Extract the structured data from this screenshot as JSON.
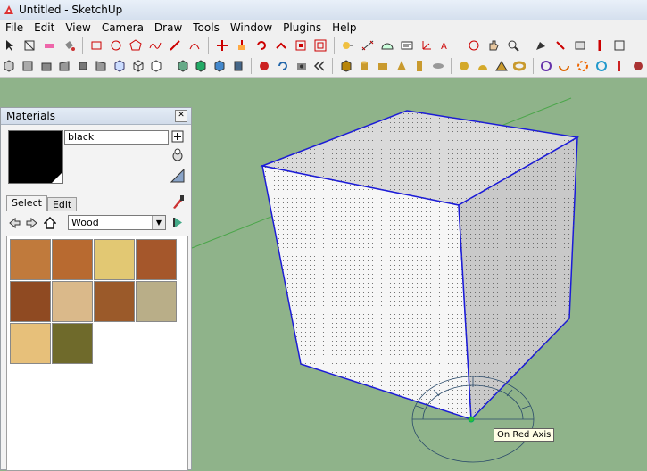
{
  "window": {
    "title": "Untitled - SketchUp"
  },
  "menu": [
    "File",
    "Edit",
    "View",
    "Camera",
    "Draw",
    "Tools",
    "Window",
    "Plugins",
    "Help"
  ],
  "materials_panel": {
    "title": "Materials",
    "material_name": "black",
    "tabs": [
      "Select",
      "Edit"
    ],
    "collection": "Wood",
    "swatch_colors": [
      "#c07a3c",
      "#b86a30",
      "#e2c873",
      "#a5572b",
      "#8f4a22",
      "#dab98a",
      "#9b5a2a",
      "#b9ae88",
      "#e7c07a",
      "#6f6a2b"
    ]
  },
  "tooltip": "On Red Axis",
  "colors": {
    "background": "#8fb38a",
    "edge": "#1b1bd8",
    "face_light": "#f4f4f4",
    "face_dark": "#c9c9c9"
  }
}
